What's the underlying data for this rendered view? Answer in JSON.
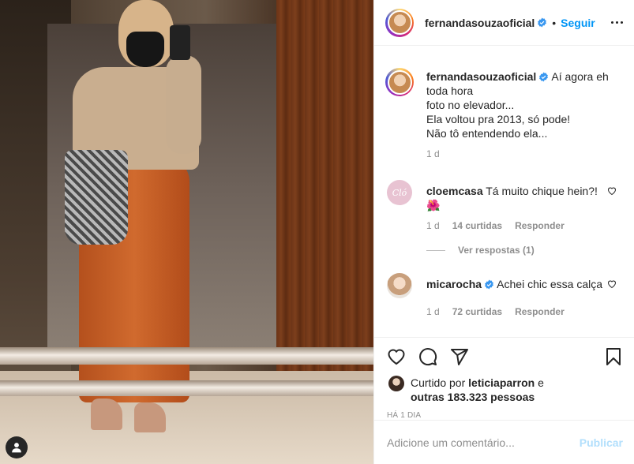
{
  "post": {
    "username": "fernandasouzaoficial",
    "follow_label": "Seguir",
    "separator": "•",
    "caption_lines": [
      "Aí agora eh toda hora",
      "foto no elevador...",
      "Ela voltou pra 2013, só pode!",
      "Não tô entendendo ela..."
    ],
    "caption_time": "1 d"
  },
  "comments": [
    {
      "username": "cloemcasa",
      "avatar_text": "Cló",
      "text": "Tá muito chique hein?! 🌺",
      "time": "1 d",
      "likes": "14 curtidas",
      "reply_label": "Responder",
      "view_replies": "Ver respostas (1)"
    },
    {
      "username": "micarocha",
      "text": "Achei chic essa calça",
      "time": "1 d",
      "likes": "72 curtidas",
      "reply_label": "Responder"
    }
  ],
  "likes": {
    "prefix": "Curtido por",
    "user": "leticiaparron",
    "conj": "e",
    "others": "outras 183.323 pessoas"
  },
  "age": "HÁ 1 DIA",
  "add_comment": {
    "placeholder": "Adicione um comentário...",
    "post_label": "Publicar"
  },
  "icons": [
    "heart-icon",
    "comment-icon",
    "share-icon",
    "bookmark-icon",
    "more-options-icon",
    "verified-icon",
    "user-tag-icon"
  ],
  "colors": {
    "link": "#0095f6",
    "muted": "#8e8e8e",
    "text": "#262626",
    "verified": "#3897f0"
  }
}
